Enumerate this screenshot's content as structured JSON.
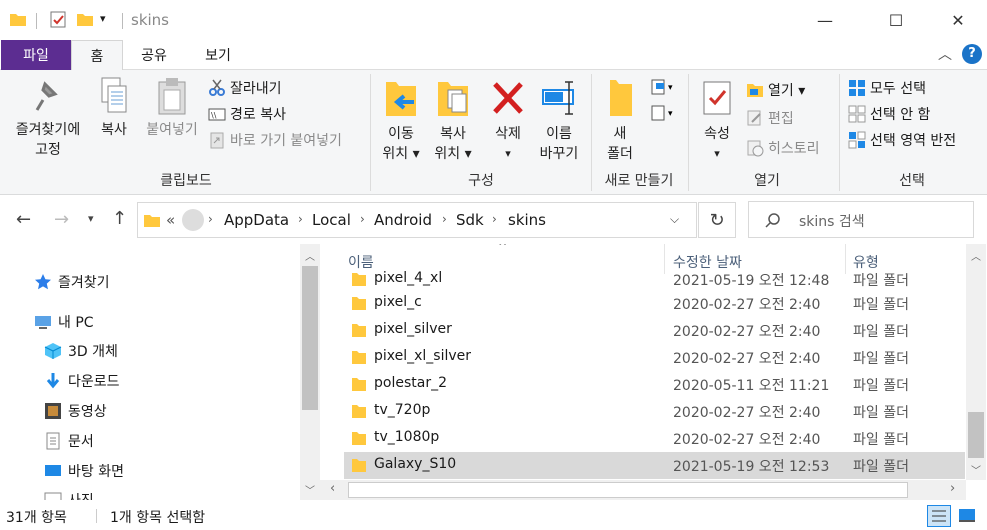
{
  "window": {
    "title": "skins",
    "minimize": "—",
    "maximize": "☐",
    "close": "✕"
  },
  "tabs": {
    "file": "파일",
    "home": "홈",
    "share": "공유",
    "view": "보기"
  },
  "ribbon": {
    "clipboard": {
      "label": "클립보드",
      "pin_line1": "즐겨찾기에",
      "pin_line2": "고정",
      "copy": "복사",
      "paste": "붙여넣기",
      "cut": "잘라내기",
      "copy_path": "경로 복사",
      "paste_shortcut": "바로 가기 붙여넣기"
    },
    "organize": {
      "label": "구성",
      "move_to_line1": "이동",
      "move_to_line2": "위치 ▾",
      "copy_to_line1": "복사",
      "copy_to_line2": "위치 ▾",
      "delete": "삭제",
      "delete_arrow": "▾",
      "rename_line1": "이름",
      "rename_line2": "바꾸기"
    },
    "new": {
      "label": "새로 만들기",
      "new_folder_line1": "새",
      "new_folder_line2": "폴더"
    },
    "open": {
      "label": "열기",
      "properties": "속성",
      "properties_arrow": "▾",
      "open": "열기 ▾",
      "edit": "편집",
      "history": "히스토리"
    },
    "select": {
      "label": "선택",
      "select_all": "모두 선택",
      "select_none": "선택 안 함",
      "invert": "선택 영역 반전"
    }
  },
  "address": {
    "prefix": "«",
    "crumbs": [
      "AppData",
      "Local",
      "Android",
      "Sdk",
      "skins"
    ],
    "search_placeholder": "skins 검색"
  },
  "nav": {
    "items": [
      {
        "label": "즐겨찾기",
        "icon": "star-icon"
      },
      {
        "label": "내 PC",
        "icon": "pc-icon"
      },
      {
        "label": "3D 개체",
        "icon": "cube-icon"
      },
      {
        "label": "다운로드",
        "icon": "download-icon"
      },
      {
        "label": "동영상",
        "icon": "video-icon"
      },
      {
        "label": "문서",
        "icon": "document-icon"
      },
      {
        "label": "바탕 화면",
        "icon": "desktop-icon"
      },
      {
        "label": "사진",
        "icon": "pictures-icon"
      }
    ]
  },
  "list": {
    "columns": {
      "name": "이름",
      "date": "수정한 날짜",
      "type": "유형"
    },
    "partial_row": {
      "name": "pixel_4_xl",
      "date": "2021-05-19 오전 12:48",
      "type": "파일 폴더"
    },
    "rows": [
      {
        "name": "pixel_c",
        "date": "2020-02-27 오전 2:40",
        "type": "파일 폴더",
        "selected": false
      },
      {
        "name": "pixel_silver",
        "date": "2020-02-27 오전 2:40",
        "type": "파일 폴더",
        "selected": false
      },
      {
        "name": "pixel_xl_silver",
        "date": "2020-02-27 오전 2:40",
        "type": "파일 폴더",
        "selected": false
      },
      {
        "name": "polestar_2",
        "date": "2020-05-11 오전 11:21",
        "type": "파일 폴더",
        "selected": false
      },
      {
        "name": "tv_720p",
        "date": "2020-02-27 오전 2:40",
        "type": "파일 폴더",
        "selected": false
      },
      {
        "name": "tv_1080p",
        "date": "2020-02-27 오전 2:40",
        "type": "파일 폴더",
        "selected": false
      },
      {
        "name": "Galaxy_S10",
        "date": "2021-05-19 오전 12:53",
        "type": "파일 폴더",
        "selected": true
      }
    ]
  },
  "status": {
    "count": "31개 항목",
    "selected": "1개 항목 선택함"
  },
  "colors": {
    "file_tab": "#5c2d91",
    "folder": "#ffc83d",
    "selection": "#d9d9d9",
    "help": "#1a73c8"
  }
}
